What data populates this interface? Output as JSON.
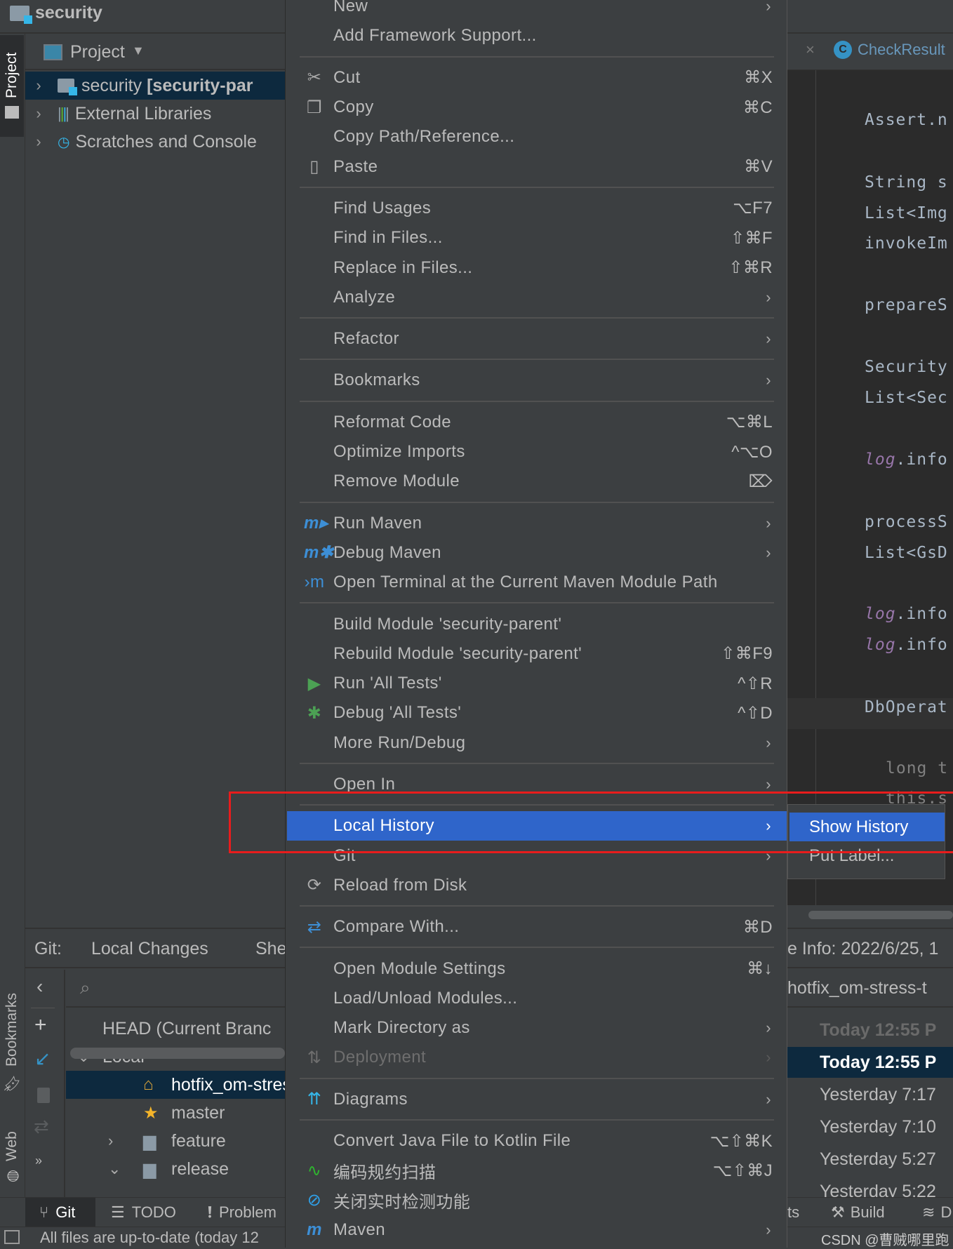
{
  "title": "security",
  "left_tabs": {
    "project": "Project",
    "bookmarks": "Bookmarks",
    "web": "Web"
  },
  "project_panel": {
    "header": "Project",
    "tree": [
      {
        "name": "security",
        "bold_suffix": "[security-par"
      },
      {
        "name": "External Libraries"
      },
      {
        "name": "Scratches and Console"
      }
    ]
  },
  "editor": {
    "tab_label": "CheckResult",
    "tab_icon_letter": "C",
    "code_lines": [
      {
        "text": "Assert.n",
        "kind": "plain"
      },
      {
        "text": "String s",
        "kind": "plain"
      },
      {
        "text": "List<Img",
        "kind": "plain"
      },
      {
        "text": "invokeIm",
        "kind": "plain"
      },
      {
        "text": "prepareS",
        "kind": "plain"
      },
      {
        "text": "Security",
        "kind": "plain"
      },
      {
        "text": "List<Sec",
        "kind": "plain"
      },
      {
        "text": "log",
        "rest": ".info",
        "kind": "log"
      },
      {
        "text": "processS",
        "kind": "plain"
      },
      {
        "text": "List<GsD",
        "kind": "plain"
      },
      {
        "text": "log",
        "rest": ".info",
        "kind": "log"
      },
      {
        "text": "log",
        "rest": ".info",
        "kind": "log"
      },
      {
        "text": "DbOperat",
        "kind": "plain"
      },
      {
        "text": "long t",
        "kind": "comment"
      },
      {
        "text": "this.s",
        "kind": "comment"
      }
    ]
  },
  "context_menu": {
    "items": [
      {
        "label": "New",
        "submenu": true
      },
      {
        "label": "Add Framework Support..."
      },
      {
        "sep": true
      },
      {
        "label": "Cut",
        "shortcut": "⌘X",
        "icon": "scissors-icon",
        "glyph": "✂"
      },
      {
        "label": "Copy",
        "shortcut": "⌘C",
        "icon": "copy-icon",
        "glyph": "❐"
      },
      {
        "label": "Copy Path/Reference..."
      },
      {
        "label": "Paste",
        "shortcut": "⌘V",
        "icon": "clipboard-icon",
        "glyph": "▯"
      },
      {
        "sep": true
      },
      {
        "label": "Find Usages",
        "shortcut": "⌥F7"
      },
      {
        "label": "Find in Files...",
        "shortcut": "⇧⌘F"
      },
      {
        "label": "Replace in Files...",
        "shortcut": "⇧⌘R"
      },
      {
        "label": "Analyze",
        "submenu": true
      },
      {
        "sep": true
      },
      {
        "label": "Refactor",
        "submenu": true
      },
      {
        "sep": true
      },
      {
        "label": "Bookmarks",
        "submenu": true
      },
      {
        "sep": true
      },
      {
        "label": "Reformat Code",
        "shortcut": "⌥⌘L"
      },
      {
        "label": "Optimize Imports",
        "shortcut": "^⌥O"
      },
      {
        "label": "Remove Module",
        "shortcut": "⌦"
      },
      {
        "sep": true
      },
      {
        "label": "Run Maven",
        "submenu": true,
        "icon": "maven-run-icon",
        "glyph": "m▸",
        "color": "#3d8fd6"
      },
      {
        "label": "Debug Maven",
        "submenu": true,
        "icon": "maven-debug-icon",
        "glyph": "m✱",
        "color": "#3d8fd6"
      },
      {
        "label": "Open Terminal at the Current Maven Module Path",
        "icon": "maven-terminal-icon",
        "glyph": "›m",
        "color": "#3d8fd6"
      },
      {
        "sep": true
      },
      {
        "label": "Build Module 'security-parent'"
      },
      {
        "label": "Rebuild Module 'security-parent'",
        "shortcut": "⇧⌘F9"
      },
      {
        "label": "Run 'All Tests'",
        "shortcut": "^⇧R",
        "icon": "run-icon",
        "glyph": "▶",
        "color": "#4ca154"
      },
      {
        "label": "Debug 'All Tests'",
        "shortcut": "^⇧D",
        "icon": "debug-bug-icon",
        "glyph": "✱",
        "color": "#4ca154"
      },
      {
        "label": "More Run/Debug",
        "submenu": true
      },
      {
        "sep": true
      },
      {
        "label": "Open In",
        "submenu": true
      },
      {
        "sep": true
      },
      {
        "label": "Local History",
        "submenu": true,
        "selected": true
      },
      {
        "label": "Git",
        "submenu": true
      },
      {
        "label": "Reload from Disk",
        "icon": "reload-icon",
        "glyph": "⟳"
      },
      {
        "sep": true
      },
      {
        "label": "Compare With...",
        "shortcut": "⌘D",
        "icon": "compare-icon",
        "glyph": "⇄",
        "color": "#3d8fd6"
      },
      {
        "sep": true
      },
      {
        "label": "Open Module Settings",
        "shortcut": "⌘↓"
      },
      {
        "label": "Load/Unload Modules..."
      },
      {
        "label": "Mark Directory as",
        "submenu": true
      },
      {
        "label": "Deployment",
        "submenu": true,
        "disabled": true,
        "icon": "deployment-icon",
        "glyph": "⇅"
      },
      {
        "sep": true
      },
      {
        "label": "Diagrams",
        "submenu": true,
        "icon": "diagrams-icon",
        "glyph": "⇈",
        "color": "#35b6e8"
      },
      {
        "sep": true
      },
      {
        "label": "Convert Java File to Kotlin File",
        "shortcut": "⌥⇧⌘K"
      },
      {
        "label": "编码规约扫描",
        "shortcut": "⌥⇧⌘J",
        "icon": "code-scan-icon",
        "glyph": "∿",
        "color": "#2fb52f"
      },
      {
        "label": "关闭实时检测功能",
        "icon": "disable-icon",
        "glyph": "⊘",
        "color": "#2fa0e8"
      },
      {
        "label": "Maven",
        "submenu": true,
        "icon": "maven-icon",
        "glyph": "m",
        "color": "#3d8fd6"
      }
    ]
  },
  "submenu": {
    "items": [
      {
        "label": "Show History",
        "selected": true
      },
      {
        "label": "Put Label..."
      }
    ]
  },
  "git_panel": {
    "title": "Git:",
    "tabs": [
      "Local Changes",
      "She"
    ],
    "info": "e Info: 2022/6/25, 1",
    "branches": [
      {
        "label": "HEAD (Current Branc"
      },
      {
        "label": "Local"
      },
      {
        "label": "hotfix_om-stres",
        "selected": true
      },
      {
        "label": "master"
      },
      {
        "label": "feature"
      },
      {
        "label": "release"
      }
    ],
    "branch_filter": "hotfix_om-stress-t",
    "commits": [
      "Today 12:55 P",
      "Today 12:55 P",
      "Yesterday 7:17",
      "Yesterday 7:10",
      "Yesterday 5:27",
      "Yesterday 5:22"
    ]
  },
  "bottom_toolbar": {
    "git": "Git",
    "todo": "TODO",
    "problems": "Problem",
    "partial": "ts",
    "build": "Build",
    "last": "D"
  },
  "status": {
    "text": "All files are up-to-date (today 12"
  },
  "watermark": "CSDN @曹贼哪里跑",
  "colors": {
    "selection": "#2f65ca",
    "tree_selection": "#0d293e",
    "highlight_box": "#e81c1c"
  }
}
